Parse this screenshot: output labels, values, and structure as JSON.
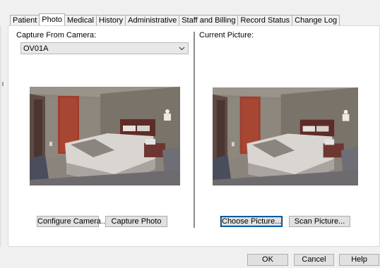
{
  "tabs": [
    {
      "label": "Patient",
      "active": false
    },
    {
      "label": "Photo",
      "active": true
    },
    {
      "label": "Medical",
      "active": false
    },
    {
      "label": "History",
      "active": false
    },
    {
      "label": "Administrative",
      "active": false
    },
    {
      "label": "Staff and Billing",
      "active": false
    },
    {
      "label": "Record Status",
      "active": false
    },
    {
      "label": "Change Log",
      "active": false
    }
  ],
  "capture": {
    "label": "Capture From Camera:",
    "camera_value": "OV01A",
    "configure_button": "Configure Camera...",
    "capture_button": "Capture Photo"
  },
  "current": {
    "label": "Current Picture:",
    "choose_button": "Choose Picture...",
    "scan_button": "Scan Picture..."
  },
  "footer": {
    "ok": "OK",
    "cancel": "Cancel",
    "help": "Help"
  },
  "colors": {
    "focus_border": "#0078d7",
    "button_face": "#e1e1e1",
    "panel_bg": "#ffffff",
    "window_bg": "#f0f0f0"
  },
  "icons": {
    "dropdown": "chevron-down-icon"
  }
}
